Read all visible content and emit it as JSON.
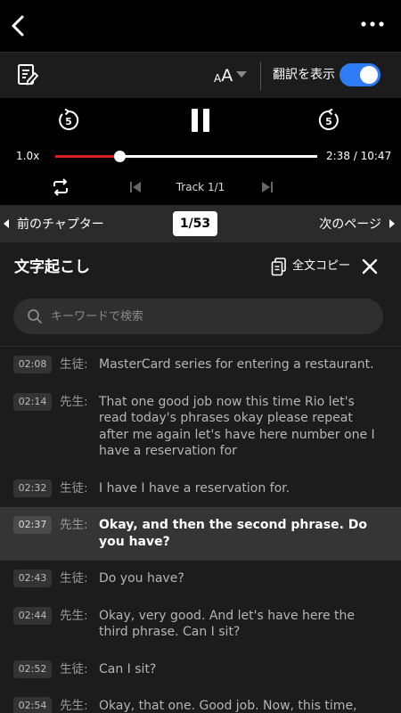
{
  "toolbar": {
    "font_size_small": "A",
    "font_size_big": "A",
    "translate_label": "翻訳を表示",
    "translate_on": true
  },
  "player": {
    "replay_seconds": "5",
    "forward_seconds": "5",
    "speed": "1.0x",
    "current_time": "2:38",
    "total_time": "10:47",
    "time_display": "2:38 / 10:47",
    "progress_fraction": 0.244,
    "track": "Track 1/1"
  },
  "chapter": {
    "prev_label": "前のチャプター",
    "page_badge": "1/53",
    "next_label": "次のページ"
  },
  "transcript": {
    "title": "文字起こし",
    "copy_label": "全文コピー",
    "search_placeholder": "キーワードで検索",
    "entries": [
      {
        "time": "02:08",
        "speaker": "生徒:",
        "text": "MasterCard series for entering a restaurant.",
        "active": false
      },
      {
        "time": "02:14",
        "speaker": "先生:",
        "text": "That one good job now this time Rio let's read today's phrases okay please repeat after me again let's have here number one I have a reservation for",
        "active": false
      },
      {
        "time": "02:32",
        "speaker": "生徒:",
        "text": "I have I have a reservation for.",
        "active": false
      },
      {
        "time": "02:37",
        "speaker": "先生:",
        "text": "Okay, and then the second phrase. Do you have?",
        "active": true
      },
      {
        "time": "02:43",
        "speaker": "生徒:",
        "text": "Do you have?",
        "active": false
      },
      {
        "time": "02:44",
        "speaker": "先生:",
        "text": "Okay, very good. And let's have here the third phrase. Can I sit?",
        "active": false
      },
      {
        "time": "02:52",
        "speaker": "生徒:",
        "text": "Can I sit?",
        "active": false
      },
      {
        "time": "02:54",
        "speaker": "先生:",
        "text": "Okay, that one. Good job. Now, this time, Ryo,",
        "active": false
      }
    ]
  },
  "colors": {
    "accent_toggle": "#2e7bf6",
    "progress_fill": "#e02020",
    "active_row": "#353535"
  },
  "icons": [
    "back-arrow-icon",
    "more-dots-icon",
    "note-edit-icon",
    "replay-5-icon",
    "pause-icon",
    "forward-5-icon",
    "repeat-icon",
    "skip-previous-icon",
    "skip-next-icon",
    "copy-icon",
    "close-icon",
    "search-icon"
  ]
}
